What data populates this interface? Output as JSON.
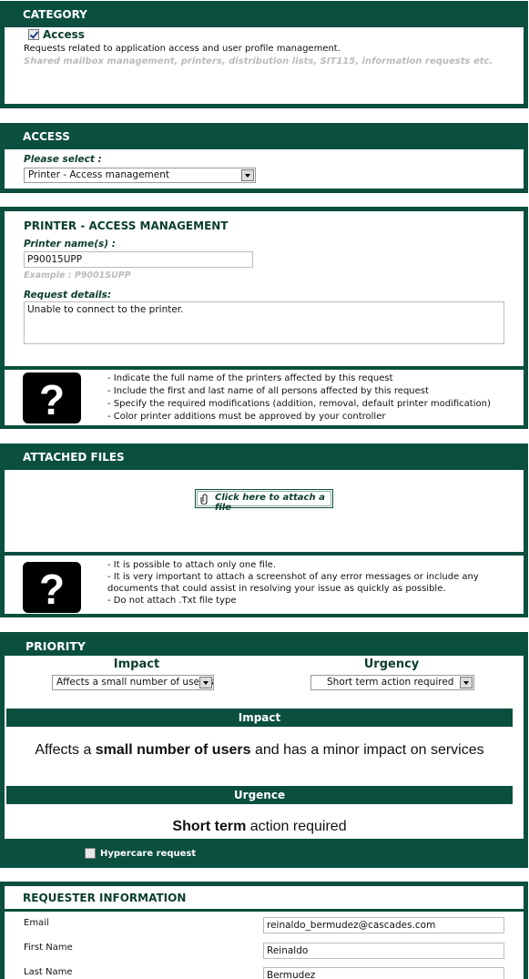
{
  "category": {
    "header": "CATEGORY",
    "checkbox_label": "Access",
    "description": "Requests related to application access and user profile management.",
    "examples": "Shared mailbox management, printers, distribution lists, SIT115, information requests etc."
  },
  "access": {
    "header": "ACCESS",
    "select_label": "Please select :",
    "selected": "Printer - Access management"
  },
  "printer": {
    "title": "PRINTER - ACCESS MANAGEMENT",
    "name_label": "Printer name(s) :",
    "name_value": "P90015UPP",
    "name_example": "Example : P9001SUPP",
    "details_label": "Request details:",
    "details_value": "Unable to connect to the printer.",
    "help_icon": "question-mark-icon",
    "help": [
      "- Indicate the full name of the printers affected by this request",
      "- Include the first and last name of all persons affected by this request",
      "- Specify the required modifications (addition, removal, default printer modification)",
      "- Color printer additions must be approved by your controller"
    ]
  },
  "attached": {
    "header": "ATTACHED FILES",
    "attach_label": "Click here to attach a file",
    "attach_icon": "paperclip-icon",
    "help_icon": "question-mark-icon",
    "help": [
      "- It is possible to attach only one file.",
      "- It is very important to attach a screenshot of any error messages or include any",
      "documents that could assist in resolving your issue as quickly as possible.",
      "- Do not attach .Txt file type"
    ]
  },
  "priority": {
    "header": "PRIORITY",
    "impact_label": "Impact",
    "impact_selected": "Affects a small number of users a",
    "urgency_label": "Urgency",
    "urgency_selected": "Short term action required",
    "impact_bar": "Impact",
    "impact_desc": {
      "pre": "Affects a ",
      "bold": "small number of users",
      "post": " and has a minor impact on services"
    },
    "urgence_bar": "Urgence",
    "urgence_desc": {
      "bold": "Short term",
      "post": " action required"
    },
    "hypercare_label": "Hypercare request"
  },
  "requester": {
    "header": "REQUESTER INFORMATION",
    "email_label": "Email",
    "email_value": "reinaldo_bermudez@cascades.com",
    "first_label": "First Name",
    "first_value": "Reinaldo",
    "last_label": "Last Name",
    "last_value": "Bermudez"
  },
  "colors": {
    "accent": "#0b4f3e"
  }
}
